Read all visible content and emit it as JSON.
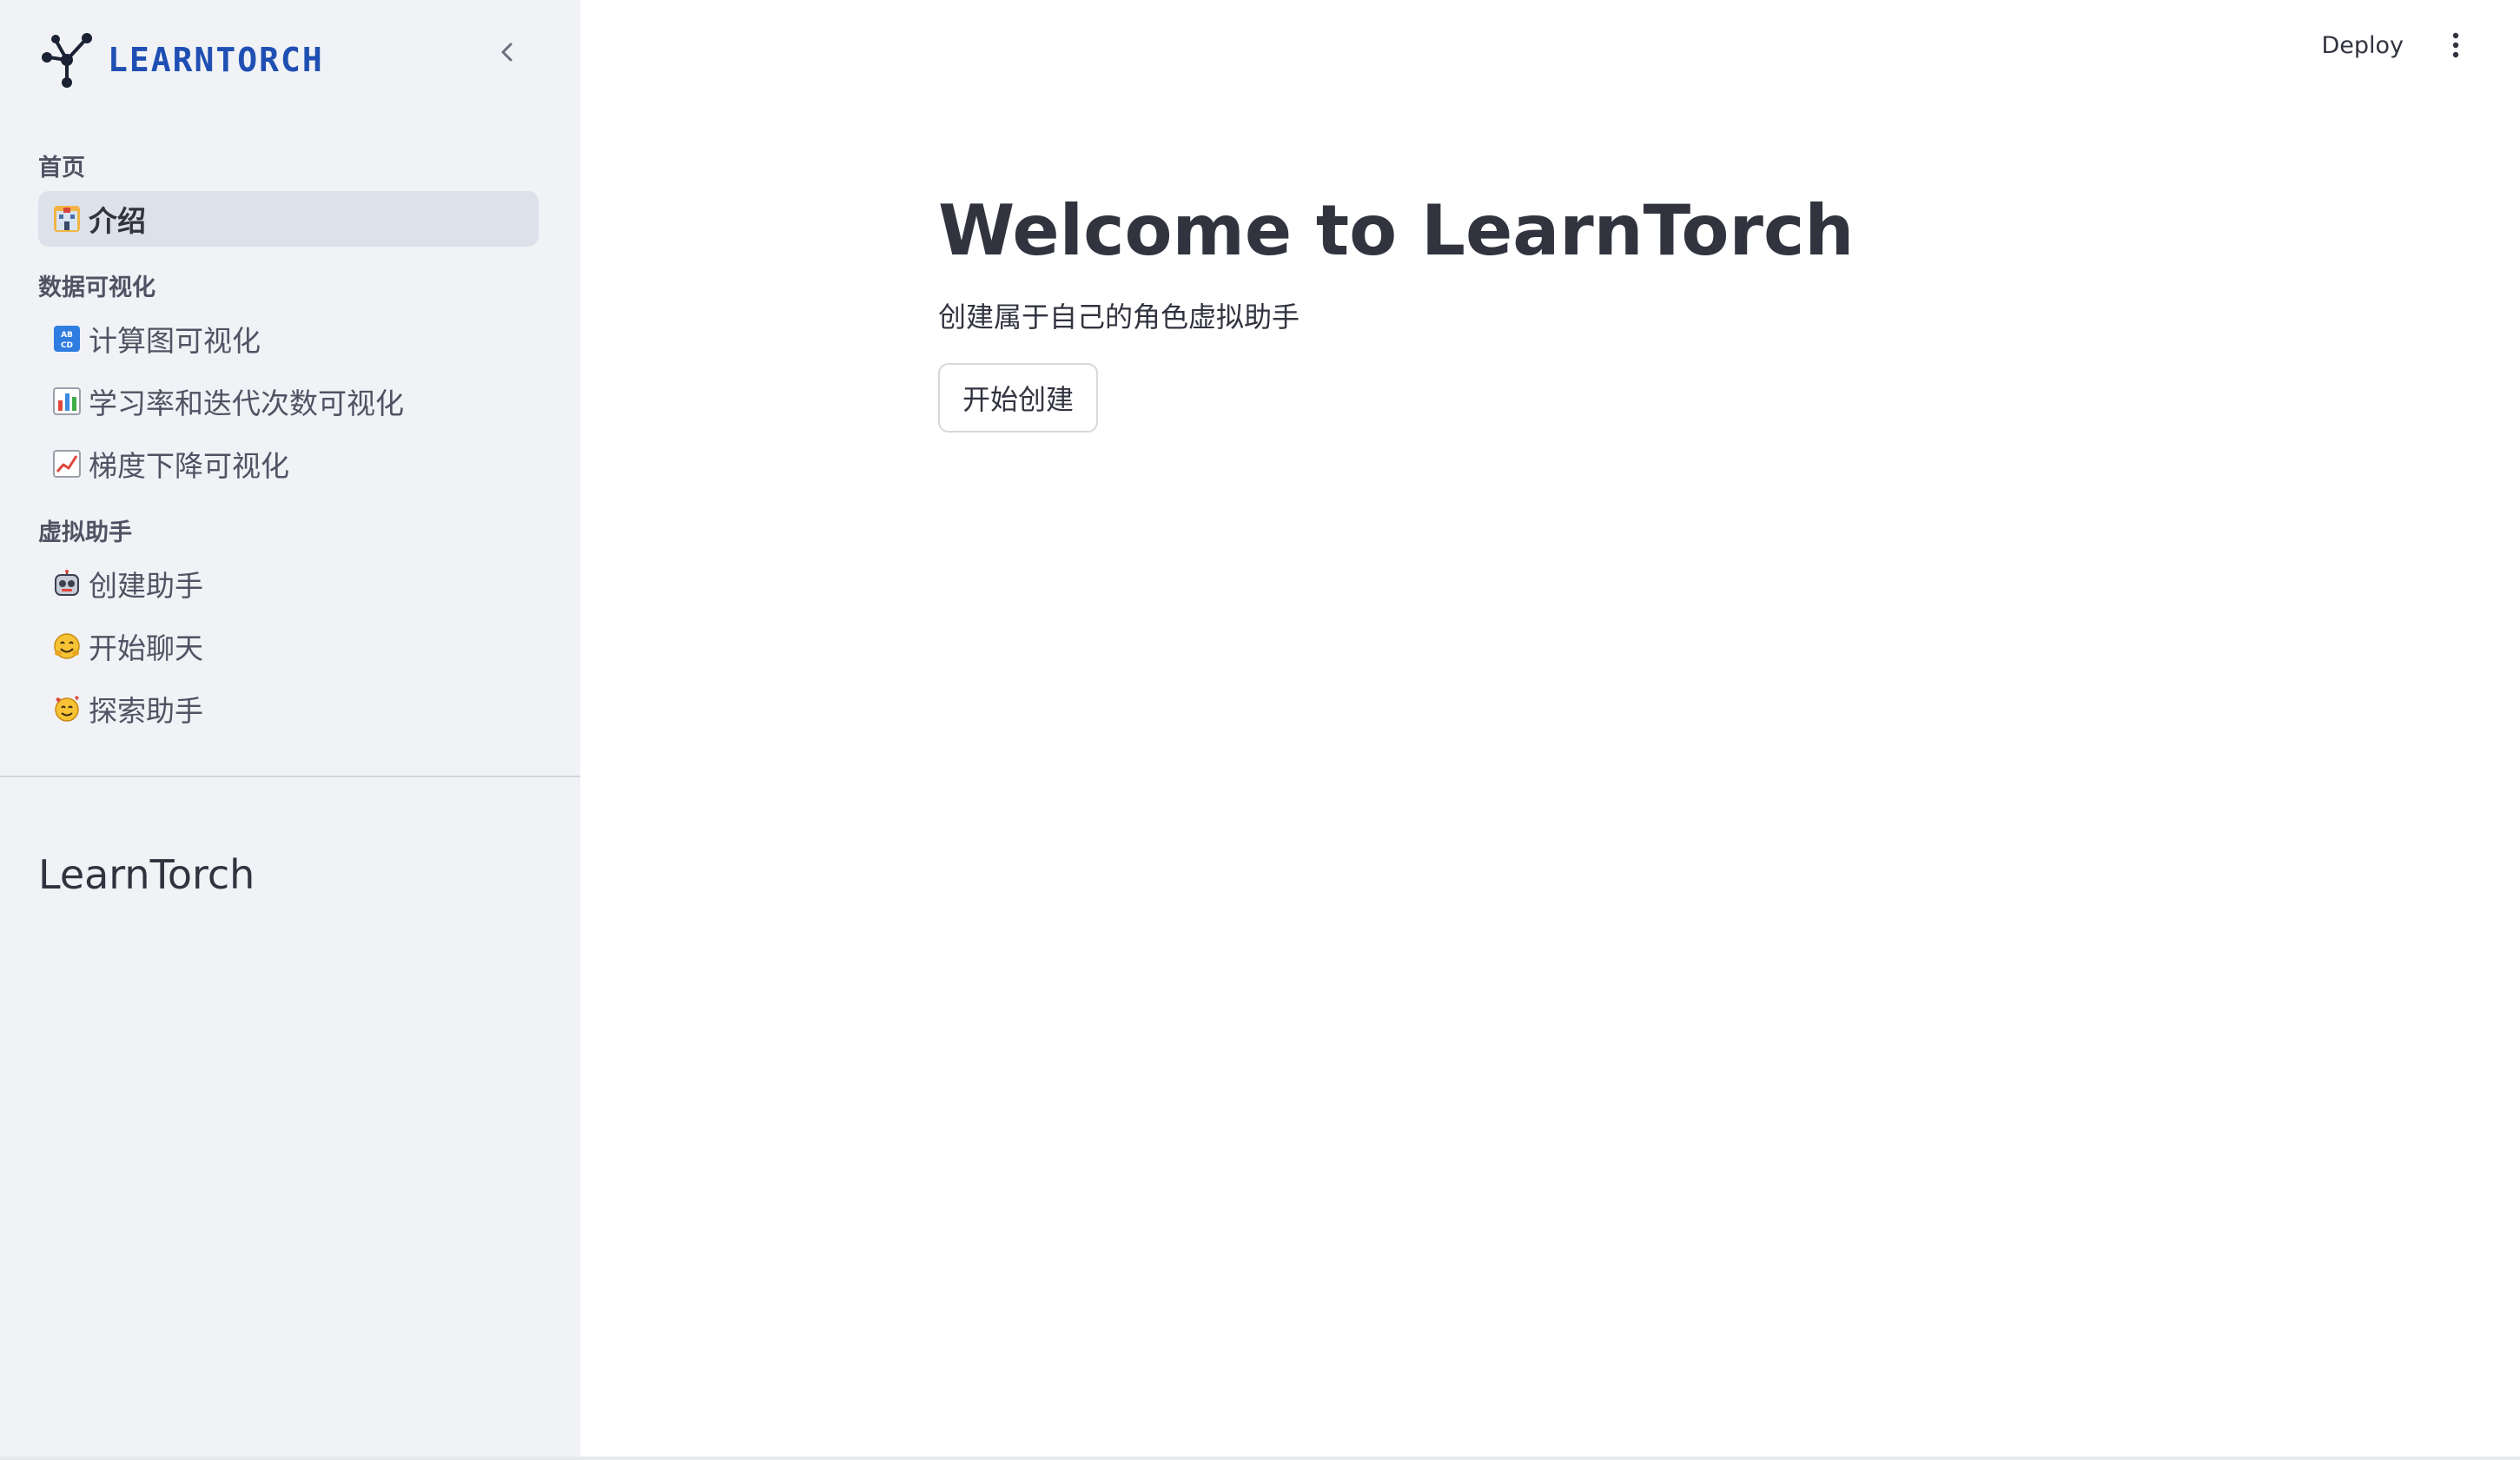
{
  "brand": {
    "logo_text": "LEARNTORCH",
    "accent_color": "#1f4fb3"
  },
  "sidebar": {
    "sections": [
      {
        "title": "首页",
        "items": [
          {
            "label": "介绍",
            "icon": "hospital-building-icon",
            "active": true
          }
        ]
      },
      {
        "title": "数据可视化",
        "items": [
          {
            "label": "计算图可视化",
            "icon": "abcd-input-icon",
            "active": false
          },
          {
            "label": "学习率和迭代次数可视化",
            "icon": "bar-chart-icon",
            "active": false
          },
          {
            "label": "梯度下降可视化",
            "icon": "chart-increasing-icon",
            "active": false
          }
        ]
      },
      {
        "title": "虚拟助手",
        "items": [
          {
            "label": "创建助手",
            "icon": "robot-face-icon",
            "active": false
          },
          {
            "label": "开始聊天",
            "icon": "hugging-face-icon",
            "active": false
          },
          {
            "label": "探索助手",
            "icon": "smiling-face-hearts-icon",
            "active": false
          }
        ]
      }
    ],
    "footer_title": "LearnTorch"
  },
  "toolbar": {
    "deploy_label": "Deploy",
    "menu_icon": "vertical-ellipsis-icon"
  },
  "main": {
    "title": "Welcome to LearnTorch",
    "subtitle": "创建属于自己的角色虚拟助手",
    "start_button_label": "开始创建"
  }
}
